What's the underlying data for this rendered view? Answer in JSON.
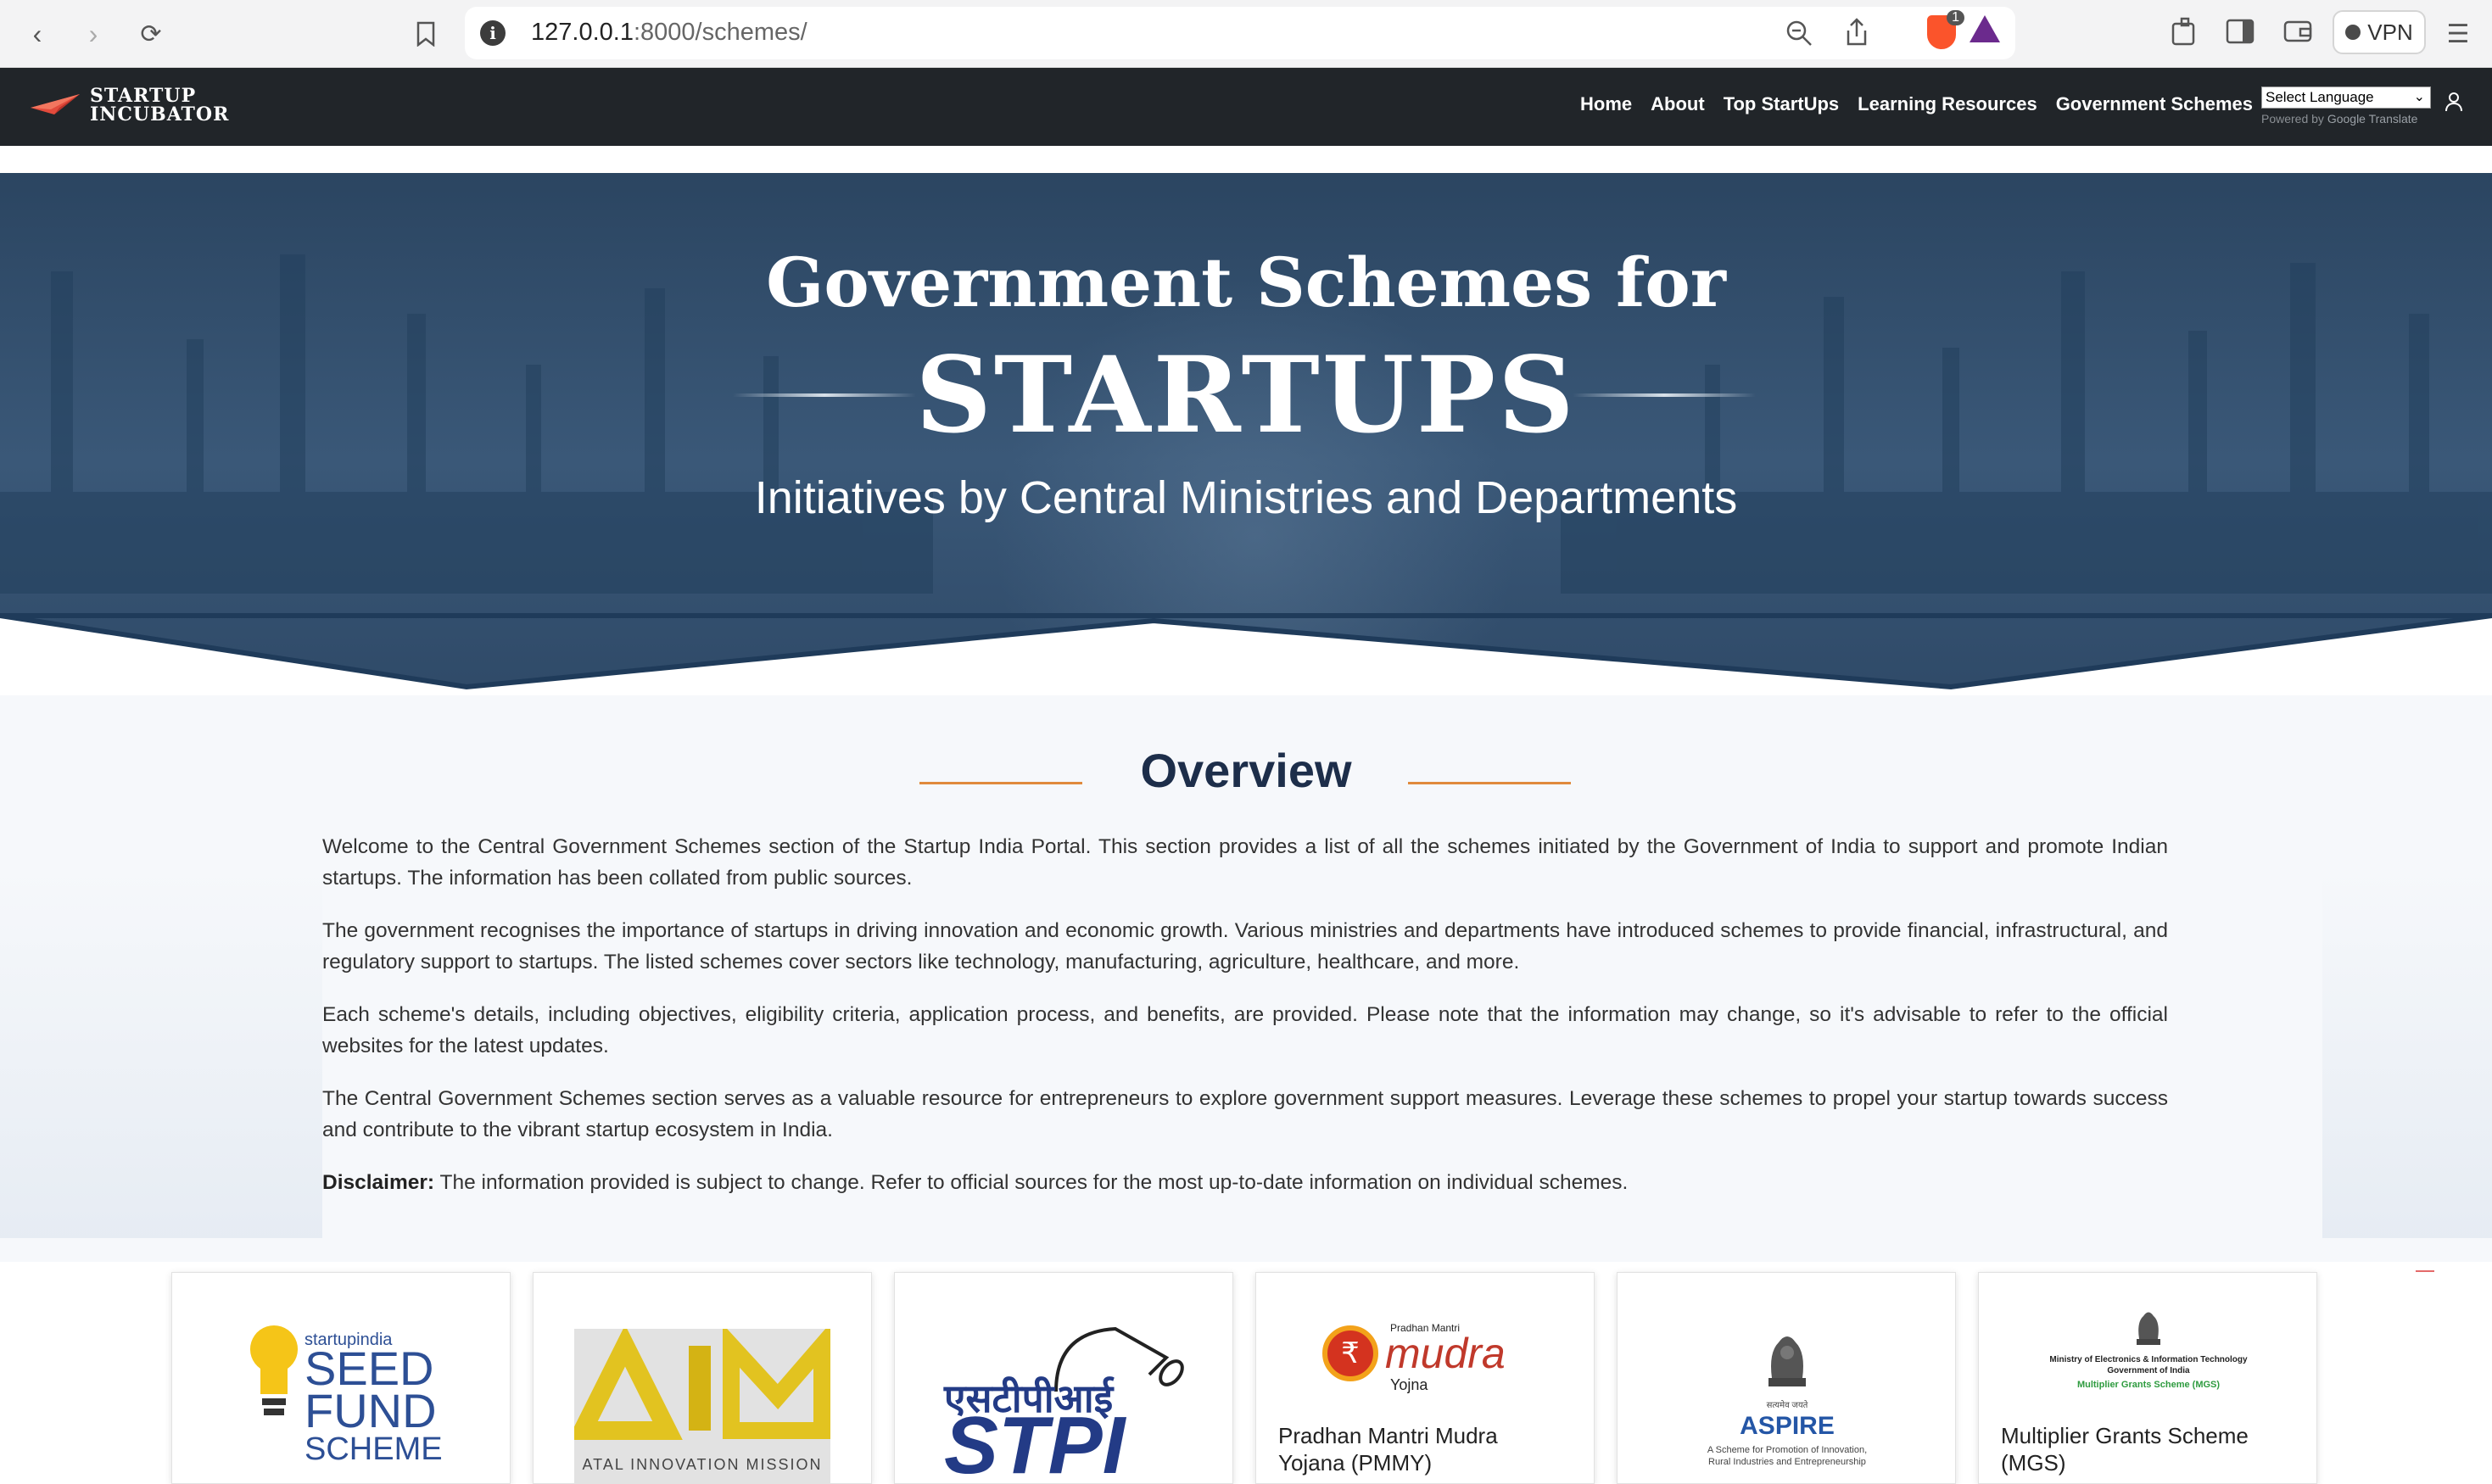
{
  "browser": {
    "url_host": "127.0.0.1",
    "url_rest": ":8000/schemes/",
    "vpn_label": "VPN",
    "brave_badge_count": "1"
  },
  "nav": {
    "brand_line1": "STARTUP",
    "brand_line2": "INCUBATOR",
    "links": [
      "Home",
      "About",
      "Top StartUps",
      "Learning Resources",
      "Government Schemes"
    ],
    "language_select": "Select Language",
    "powered_by": "Powered by",
    "google_translate": "Google Translate"
  },
  "hero": {
    "title_line1": "Government Schemes for",
    "title_line2": "STARTUPS",
    "subtitle": "Initiatives by Central Ministries and Departments"
  },
  "overview": {
    "heading": "Overview",
    "paragraphs": [
      "Welcome to the Central Government Schemes section of the Startup India Portal. This section provides a list of all the schemes initiated by the Government of India to support and promote Indian startups. The information has been collated from public sources.",
      "The government recognises the importance of startups in driving innovation and economic growth. Various ministries and departments have introduced schemes to provide financial, infrastructural, and regulatory support to startups. The listed schemes cover sectors like technology, manufacturing, agriculture, healthcare, and more.",
      "Each scheme's details, including objectives, eligibility criteria, application process, and benefits, are provided. Please note that the information may change, so it's advisable to refer to the official websites for the latest updates.",
      "The Central Government Schemes section serves as a valuable resource for entrepreneurs to explore government support measures. Leverage these schemes to propel your startup towards success and contribute to the vibrant startup ecosystem in India."
    ],
    "disclaimer_label": "Disclaimer:",
    "disclaimer_text": " The information provided is subject to change. Refer to official sources for the most up-to-date information on individual schemes."
  },
  "cards": {
    "seed": {
      "brand": "startupindia",
      "l1": "SEED",
      "l2": "FUND",
      "l3": "SCHEME"
    },
    "aim": {
      "caption": "ATAL INNOVATION MISSION"
    },
    "stpi": {
      "hindi": "एसटीपीआई",
      "latin": "STPI"
    },
    "mudra": {
      "top": "Pradhan Mantri",
      "word": "mudra",
      "sub": "Yojna",
      "title_l1": "Pradhan Mantri Mudra",
      "title_l2": "Yojana (PMMY)"
    },
    "aspire": {
      "motto": "सत्यमेव जयते",
      "name": "ASPIRE",
      "desc_l1": "A Scheme for Promotion of Innovation,",
      "desc_l2": "Rural Industries and Entrepreneurship"
    },
    "mgs": {
      "ministry_l1": "Ministry of Electronics & Information Technology",
      "ministry_l2": "Government of India",
      "scheme_green": "Multiplier Grants Scheme (MGS)",
      "title_l1": "Multiplier Grants Scheme",
      "title_l2": "(MGS)"
    }
  }
}
